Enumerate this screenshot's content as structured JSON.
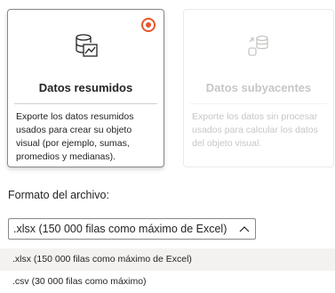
{
  "cards": [
    {
      "title": "Datos resumidos",
      "description": "Exporte los datos resumidos usados para crear su objeto visual (por ejemplo, sumas, promedios y medianas).",
      "icon": "summarized-data-icon",
      "selected": true
    },
    {
      "title": "Datos subyacentes",
      "description": "Exporte los datos sin procesar usados para calcular los datos del objeto visual.",
      "icon": "underlying-data-icon",
      "selected": false
    }
  ],
  "format": {
    "label": "Formato del archivo:",
    "selected_value": ".xlsx (150 000 filas como máximo de Excel)",
    "options": [
      ".xlsx (150 000 filas como máximo de Excel)",
      ".csv (30 000 filas como máximo)"
    ]
  },
  "colors": {
    "accent": "#e8562a",
    "disabled_text": "#c8c6c4",
    "hover_bg": "#f3f2f1"
  }
}
